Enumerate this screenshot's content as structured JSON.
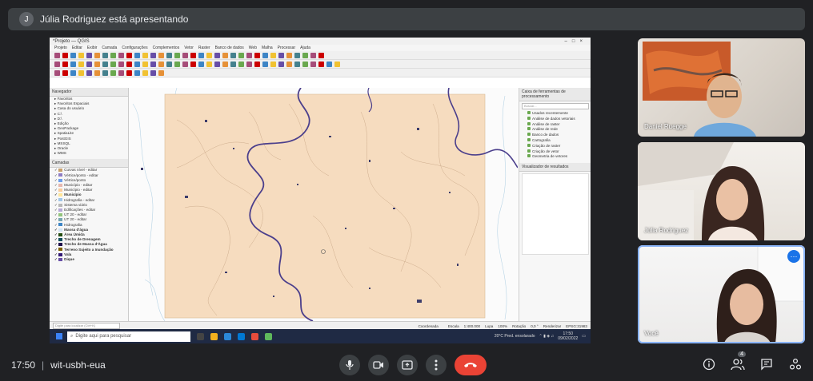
{
  "presenter_bar": {
    "avatar_initial": "J",
    "text": "Júlia Rodriguez está apresentando"
  },
  "qgis": {
    "title": "*Projeto — QGIS",
    "menu": [
      "Projeto",
      "Editar",
      "Exibir",
      "Camada",
      "Configurações",
      "Complementos",
      "Vetor",
      "Raster",
      "Banco de dados",
      "Web",
      "Malha",
      "Processar",
      "Ajuda"
    ],
    "browser_title": "Navegador",
    "browser_items": [
      "Favoritos",
      "Favoritos Espaciais",
      "Casa do usuário",
      "C:\\",
      "D:\\",
      "Edição",
      "GeoPackage",
      "SpatiaLite",
      "PostGIS",
      "MSSQL",
      "Oracle",
      "WMS"
    ],
    "layers_title": "Camadas",
    "layers": [
      {
        "label": "Curvas nível - editar",
        "color": "#c7a06b",
        "bold": false
      },
      {
        "label": "Vértice/ponto - editar",
        "color": "#8e7cc3",
        "bold": false
      },
      {
        "label": "Vértice/ponto",
        "color": "#6d9eeb",
        "bold": false
      },
      {
        "label": "Município - editar",
        "color": "#e6b8af",
        "bold": false
      },
      {
        "label": "Município - editar",
        "color": "#f9cb9c",
        "bold": false
      },
      {
        "label": "Município",
        "color": "#ffe599",
        "bold": true
      },
      {
        "label": "Hidrografia - editar",
        "color": "#9fc5e8",
        "bold": false
      },
      {
        "label": "Sistema viário",
        "color": "#b7b7b7",
        "bold": false
      },
      {
        "label": "Edificações - editar",
        "color": "#b4a7d6",
        "bold": false
      },
      {
        "label": "UT 20 - editar",
        "color": "#93c47d",
        "bold": false
      },
      {
        "label": "UT 20 - editar",
        "color": "#76a5af",
        "bold": false
      },
      {
        "label": "Hidrografia",
        "color": "#3d85c6",
        "bold": false
      },
      {
        "label": "Massa d'água",
        "color": "#cfe2f3",
        "bold": true
      },
      {
        "label": "Área Úmida",
        "color": "#274e13",
        "bold": true
      },
      {
        "label": "Trecho de Drenagem",
        "color": "#134f5c",
        "bold": true
      },
      {
        "label": "Trecho de Massa d'Água",
        "color": "#20124d",
        "bold": true
      },
      {
        "label": "Terreno Sujeito a Inundação",
        "color": "#7f6000",
        "bold": true
      },
      {
        "label": "Vala",
        "color": "#351c75",
        "bold": true
      },
      {
        "label": "Dique",
        "color": "#674ea7",
        "bold": true
      }
    ],
    "toolbox_title": "Caixa de ferramentas de processamento",
    "toolbox_search_placeholder": "Buscar...",
    "toolbox_items": [
      "Usados recentemente",
      "Análise de dados vetoriais",
      "Análise de raster",
      "Análise de rede",
      "Banco de dados",
      "Cartografia",
      "Criação de raster",
      "Criação de vetor",
      "Geometria de vetores"
    ],
    "results_title": "Visualizador de resultados",
    "search_placeholder": "Digite para localizar (Ctrl+K)",
    "status": {
      "coordinate_label": "Coordenada",
      "coordinate": "",
      "scale_label": "Escala",
      "scale": "1:400.000",
      "magnifier_label": "Lupa",
      "magnifier": "100%",
      "rotation_label": "Rotação",
      "rotation": "0,0 °",
      "render_label": "Renderizar",
      "crs": "EPSG:31983"
    }
  },
  "taskbar": {
    "search_placeholder": "Digite aqui para pesquisar",
    "weather": "20°C Pred. ensolarado",
    "time": "17:50",
    "date": "09/02/2022"
  },
  "participants": [
    {
      "name": "Daniel Ruegge",
      "active": false
    },
    {
      "name": "Júlia Rodriguez",
      "active": false
    },
    {
      "name": "Você",
      "active": true
    }
  ],
  "meeting": {
    "time": "17:50",
    "code": "wit-usbh-eua",
    "participant_count": "4",
    "accent_end_call": "#ea4335",
    "accent_active": "#8ab4f8"
  }
}
